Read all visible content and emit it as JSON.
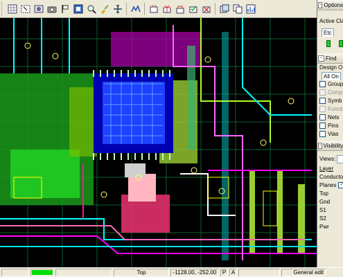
{
  "toolbar": {
    "buttons": [
      {
        "icon": "grid-icon"
      },
      {
        "icon": "select-icon"
      },
      {
        "icon": "image-icon"
      },
      {
        "icon": "camera-icon"
      },
      {
        "icon": "flag-icon"
      },
      {
        "icon": "component-icon"
      },
      {
        "icon": "zoom-icon"
      },
      {
        "icon": "brush-icon"
      },
      {
        "icon": "move-icon"
      },
      {
        "icon": "route-icon"
      },
      {
        "icon": "part-icon"
      },
      {
        "icon": "gift-icon"
      },
      {
        "icon": "lock-icon"
      },
      {
        "icon": "check-icon"
      },
      {
        "icon": "unroute-icon"
      },
      {
        "icon": "window-icon"
      },
      {
        "icon": "copy-icon"
      },
      {
        "icon": "chart-icon"
      }
    ]
  },
  "panel": {
    "options": {
      "title": "Options",
      "active_class_label": "Active Cla",
      "active_class_value": "Etc"
    },
    "find": {
      "title": "Find",
      "design_label": "Design O",
      "all_on_label": "All On",
      "items": [
        {
          "label": "Group",
          "enabled": true
        },
        {
          "label": "Comp",
          "enabled": false
        },
        {
          "label": "Symb",
          "enabled": true
        },
        {
          "label": "Functi",
          "enabled": false
        },
        {
          "label": "Nets",
          "enabled": true
        },
        {
          "label": "Pins",
          "enabled": true
        },
        {
          "label": "Vias",
          "enabled": true
        }
      ]
    },
    "visibility": {
      "title": "Visibility",
      "views_label": "Views:",
      "layer_label": "Layer",
      "conductors_label": "Conductors",
      "planes_label": "Planes",
      "layers": [
        "Top",
        "Gnd",
        "S1",
        "S2",
        "Pwr"
      ]
    }
  },
  "status": {
    "layer": "Top",
    "coords": "-1128.00, -252.00",
    "p_label": "P",
    "a_label": "A",
    "mode": "General edit"
  },
  "colors": {
    "canvas_bg": "#000000",
    "progress_fill": "#00dd00"
  }
}
